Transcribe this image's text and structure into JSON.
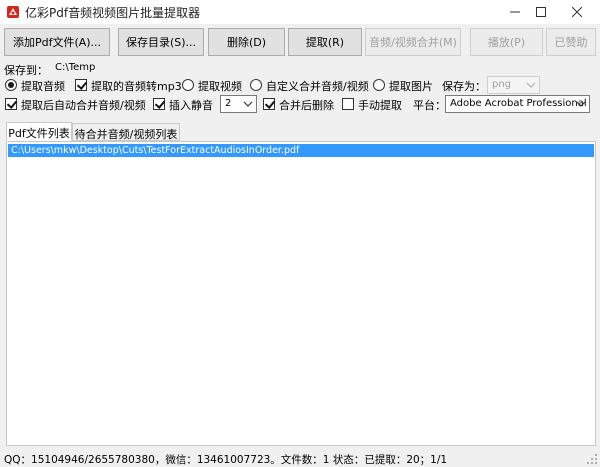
{
  "window": {
    "title": "亿彩Pdf音频视频图片批量提取器",
    "icon": "pdf-app-icon",
    "controls": [
      "minimize-icon",
      "maximize-icon",
      "close-icon"
    ]
  },
  "toolbar": {
    "add_pdf": "添加Pdf文件(A)...",
    "save_dir": "保存目录(S)...",
    "delete": "删除(D)",
    "extract": "提取(R)",
    "merge_av": "音频/视频合并(M)",
    "play": "播放(P)",
    "donated": "已赞助"
  },
  "options": {
    "save_to_label": "保存到：",
    "save_to_value": "C:\\Temp",
    "extract_audio": "提取音频",
    "convert_mp3": "提取的音频转mp3",
    "extract_video": "提取视频",
    "custom_merge": "自定义合并音频/视频",
    "extract_image": "提取图片",
    "save_as_label": "保存为：",
    "save_as_value": "png",
    "auto_merge": "提取后自动合并音频/视频",
    "insert_silence": "插入静音",
    "silence_value": "2",
    "delete_after_merge": "合并后删除",
    "manual_extract": "手动提取",
    "platform_label": "平台：",
    "platform_value": "Adobe Acrobat Professional"
  },
  "tabs": [
    {
      "label": "Pdf文件列表",
      "active": true
    },
    {
      "label": "待合并音频/视频列表",
      "active": false
    }
  ],
  "files": [
    "C:\\Users\\mkw\\Desktop\\Cuts\\TestForExtractAudiosInOrder.pdf"
  ],
  "status": {
    "text": "QQ：15104946/2655780380，微信：13461007723。文件数：1  状态：已提取：20；1/1"
  },
  "colors": {
    "selection": "#3399ff",
    "icon_red": "#d9261c"
  }
}
